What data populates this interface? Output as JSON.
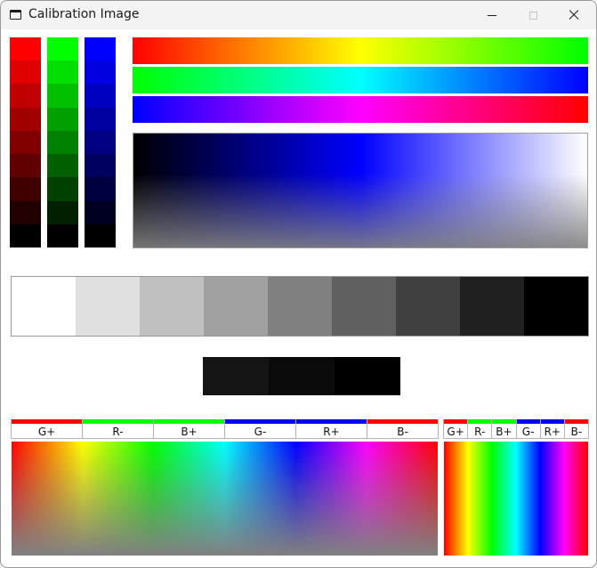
{
  "window": {
    "title": "Calibration Image",
    "icon": "window-app-icon"
  },
  "controls": {
    "minimize": "minimize-icon",
    "maximize": "maximize-icon",
    "close": "close-icon"
  },
  "channel_columns": [
    {
      "name": "red",
      "steps": [
        "#ff0000",
        "#e00000",
        "#c00000",
        "#a00000",
        "#800000",
        "#600000",
        "#400000",
        "#200000",
        "#000000"
      ]
    },
    {
      "name": "green",
      "steps": [
        "#00ff00",
        "#00e000",
        "#00c000",
        "#00a000",
        "#008000",
        "#006000",
        "#004000",
        "#002000",
        "#000000"
      ]
    },
    {
      "name": "blue",
      "steps": [
        "#0000ff",
        "#0000e0",
        "#0000c0",
        "#0000a0",
        "#000080",
        "#000060",
        "#000040",
        "#000020",
        "#000000"
      ]
    }
  ],
  "hue_strips": [
    {
      "from": "#ff0000",
      "mid": "#ffff00",
      "to": "#00ff00"
    },
    {
      "from": "#00ff00",
      "mid": "#00ffff",
      "to": "#0000ff"
    },
    {
      "from": "#0000ff",
      "mid": "#ff00ff",
      "to": "#ff0000"
    }
  ],
  "gray_scale": [
    "#ffffff",
    "#e0e0e0",
    "#c0c0c0",
    "#a0a0a0",
    "#808080",
    "#606060",
    "#404040",
    "#202020",
    "#000000"
  ],
  "dark_steps": [
    "#141414",
    "#0a0a0a",
    "#000000"
  ],
  "wide_labels": [
    {
      "text": "G+",
      "color": "#ff0000"
    },
    {
      "text": "R-",
      "color": "#00ff00"
    },
    {
      "text": "B+",
      "color": "#00ff00"
    },
    {
      "text": "G-",
      "color": "#0000ff"
    },
    {
      "text": "R+",
      "color": "#0000ff"
    },
    {
      "text": "B-",
      "color": "#ff0000"
    }
  ],
  "narrow_labels": [
    {
      "text": "G+",
      "color": "#ff0000"
    },
    {
      "text": "R-",
      "color": "#00ff00"
    },
    {
      "text": "B+",
      "color": "#00ff00"
    },
    {
      "text": "G-",
      "color": "#0000ff"
    },
    {
      "text": "R+",
      "color": "#0000ff"
    },
    {
      "text": "B-",
      "color": "#ff0000"
    }
  ]
}
